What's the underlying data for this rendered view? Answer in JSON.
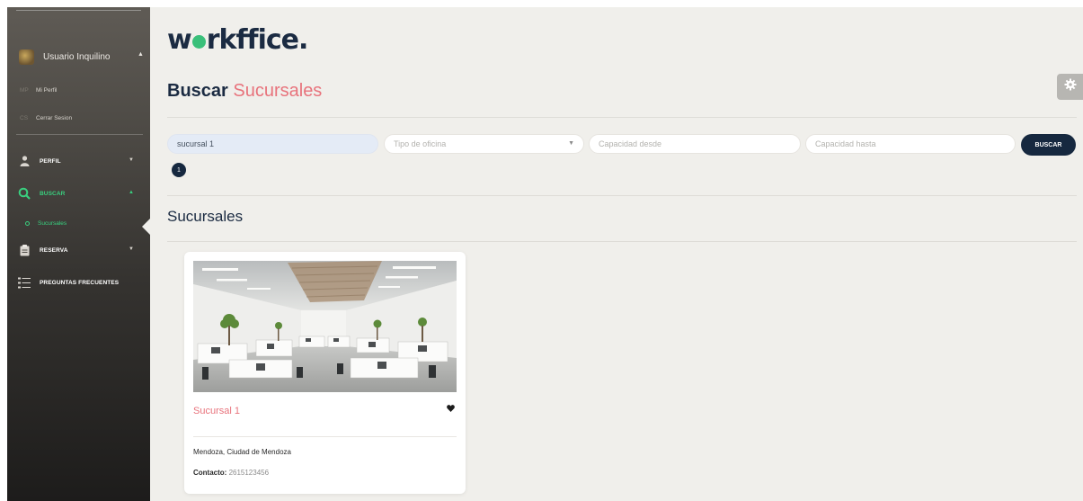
{
  "sidebar": {
    "user": {
      "name": "Usuario Inquilino"
    },
    "user_menu": [
      {
        "abbr": "MP",
        "label": "Mi Perfil"
      },
      {
        "abbr": "CS",
        "label": "Cerrar Sesion"
      }
    ],
    "nav": [
      {
        "label": "PERFIL",
        "icon": "person-icon"
      },
      {
        "label": "BUSCAR",
        "icon": "search-icon",
        "active": true
      },
      {
        "label": "RESERVA",
        "icon": "clipboard-icon"
      },
      {
        "label": "PREGUNTAS FRECUENTES",
        "icon": "list-icon"
      }
    ],
    "active_sub": "Sucursales"
  },
  "header": {
    "logo": "workffice.",
    "title_main": "Buscar",
    "title_accent": "Sucursales"
  },
  "filters": {
    "name_value": "sucursal 1",
    "office_type_placeholder": "Tipo de oficina",
    "capacity_from_placeholder": "Capacidad desde",
    "capacity_to_placeholder": "Capacidad hasta",
    "search_button": "BUSCAR"
  },
  "pagination": {
    "current": "1"
  },
  "results": {
    "section_title": "Sucursales",
    "cards": [
      {
        "name": "Sucursal 1",
        "location": "Mendoza, Ciudad de Mendoza",
        "contact_label": "Contacto:",
        "contact_value": "2615123456"
      }
    ]
  },
  "colors": {
    "sidebar_active": "#39d07f",
    "navy": "#16283f",
    "accent_pink": "#e8737c",
    "main_bg": "#f0efeb"
  }
}
